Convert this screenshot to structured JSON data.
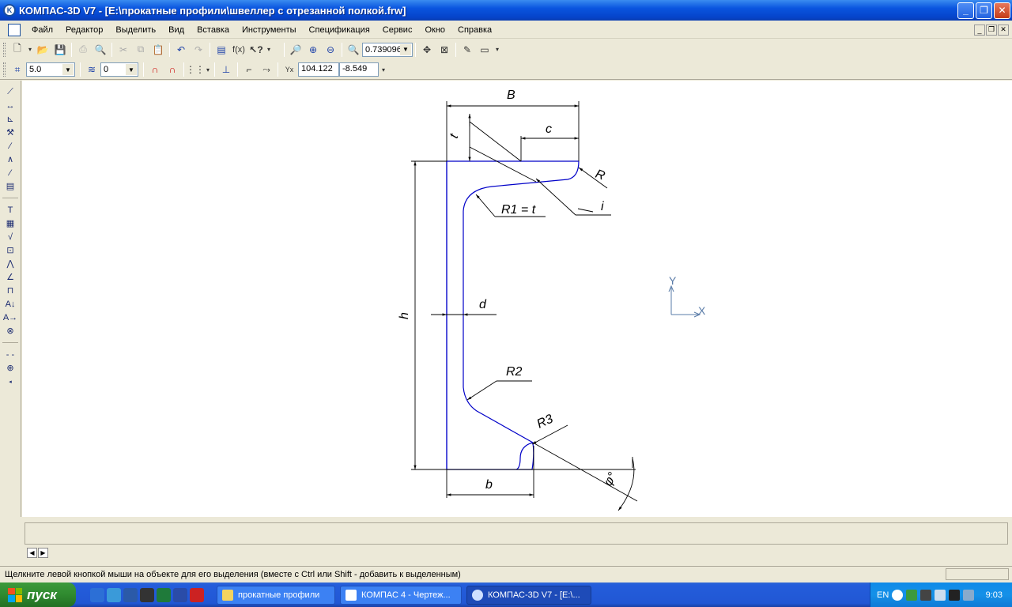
{
  "window": {
    "title": "КОМПАС-3D V7 - [E:\\прокатные профили\\швеллер с отрезанной полкой.frw]",
    "app_icon": "kompas-icon"
  },
  "menu": {
    "items": [
      "Файл",
      "Редактор",
      "Выделить",
      "Вид",
      "Вставка",
      "Инструменты",
      "Спецификация",
      "Сервис",
      "Окно",
      "Справка"
    ]
  },
  "toolbar_main": {
    "zoom_value": "0.739096"
  },
  "toolbar_current": {
    "step_value": "5.0",
    "layer_value": "0",
    "coord_x": "104.122",
    "coord_y": "-8.549"
  },
  "drawing": {
    "labels": {
      "B": "B",
      "c": "c",
      "t": "t",
      "R": "R",
      "R1": "R1 = t",
      "i": "i",
      "d": "d",
      "h": "h",
      "R2": "R2",
      "R3": "R3",
      "b": "b",
      "phi": "φ°"
    },
    "axis_y": "Y",
    "axis_x": "X",
    "line_color": "#0000c8"
  },
  "status": {
    "message": "Щелкните левой кнопкой мыши на объекте для его выделения (вместе с Ctrl или Shift - добавить к выделенным)"
  },
  "taskbar": {
    "start_label": "пуск",
    "tasks": [
      "прокатные профили",
      "КОМПАС 4 - Чертеж...",
      "КОМПАС-3D V7 - [E:\\..."
    ],
    "language": "EN",
    "clock": "9:03"
  }
}
